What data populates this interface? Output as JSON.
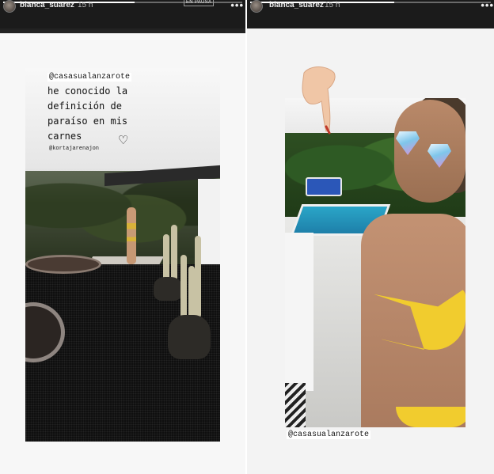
{
  "stories": [
    {
      "username": "blanca_suarez",
      "time": "15 h",
      "badge": "EN PAUSA",
      "progress": 0.55,
      "mention_top": "@casasualanzarote",
      "caption": "he conocido la\ndefinición de\nparaíso en mis\ncarnes",
      "heart_icon": "heart-outline-icon",
      "mention_small": "@kortajarenajon"
    },
    {
      "username": "blanca_suarez",
      "time": "15 h",
      "progress": 0.6,
      "sticker": "hand-pointing-down-icon",
      "effect": "diamond-glasses",
      "mention_bottom": "@casasualanzarote"
    }
  ],
  "menu_glyph": "•••",
  "heart_glyph": "♡"
}
